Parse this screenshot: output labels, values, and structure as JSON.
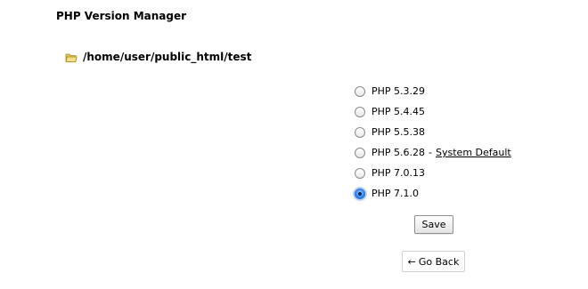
{
  "page": {
    "title": "PHP Version Manager"
  },
  "directory": {
    "path": "/home/user/public_html/test",
    "icon": "folder-open-icon"
  },
  "versions": [
    {
      "label": "PHP 5.3.29",
      "selected": false
    },
    {
      "label": "PHP 5.4.45",
      "selected": false
    },
    {
      "label": "PHP 5.5.38",
      "selected": false
    },
    {
      "label": "PHP 5.6.28",
      "selected": false,
      "separator": "-",
      "note": "System Default"
    },
    {
      "label": "PHP 7.0.13",
      "selected": false
    },
    {
      "label": "PHP 7.1.0",
      "selected": true
    }
  ],
  "actions": {
    "save_label": "Save",
    "back_arrow": "←",
    "back_label": "Go Back"
  },
  "colors": {
    "radio_selected": "#3b8ef0",
    "folder": "#f2d36b"
  }
}
